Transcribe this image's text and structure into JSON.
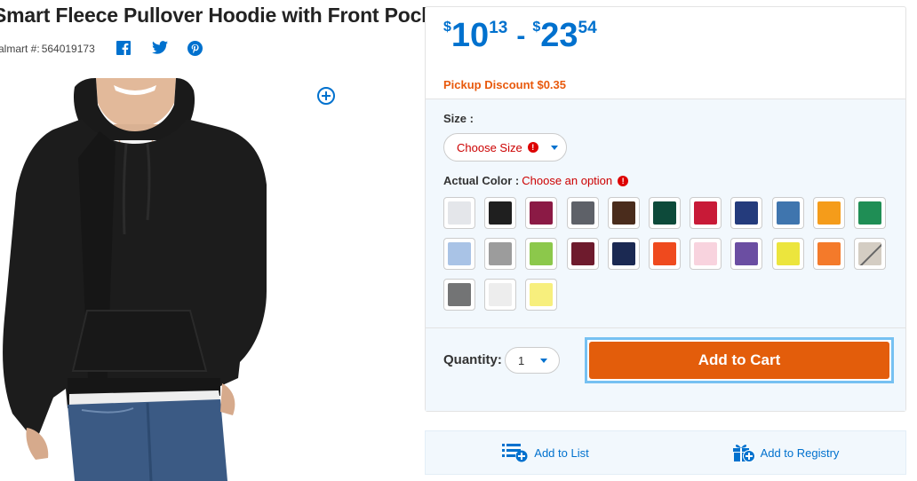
{
  "product": {
    "title": "Smart Fleece Pullover Hoodie with Front Pocket",
    "sku_label": "almart #:",
    "sku": "564019173"
  },
  "share": {
    "icons": [
      "facebook-icon",
      "twitter-icon",
      "pinterest-icon"
    ]
  },
  "price": {
    "currency": "$",
    "min_dollars": "10",
    "min_cents": "13",
    "separator": "-",
    "max_dollars": "23",
    "max_cents": "54",
    "color": "#0071ce"
  },
  "pickup_discount": "Pickup Discount $0.35",
  "size": {
    "label": "Size :",
    "selected": "Choose Size",
    "error_icon": "!"
  },
  "color": {
    "label": "Actual Color :",
    "hint": "Choose an option",
    "swatches": [
      {
        "name": "light-gray",
        "hex": "#e4e6ea"
      },
      {
        "name": "black",
        "hex": "#1f1f1f"
      },
      {
        "name": "maroon",
        "hex": "#8b1a45"
      },
      {
        "name": "charcoal",
        "hex": "#5e6168"
      },
      {
        "name": "brown",
        "hex": "#4a2c1c"
      },
      {
        "name": "forest-green",
        "hex": "#0d4a3a"
      },
      {
        "name": "red",
        "hex": "#c81a37"
      },
      {
        "name": "navy",
        "hex": "#243b7c"
      },
      {
        "name": "steel-blue",
        "hex": "#3f75ae"
      },
      {
        "name": "gold",
        "hex": "#f59c1a"
      },
      {
        "name": "kelly-green",
        "hex": "#1f8e55"
      },
      {
        "name": "light-blue",
        "hex": "#a9c3e6"
      },
      {
        "name": "heather-gray",
        "hex": "#9c9c9c"
      },
      {
        "name": "lime",
        "hex": "#8cc84b"
      },
      {
        "name": "burgundy",
        "hex": "#6e1b2d"
      },
      {
        "name": "deep-navy",
        "hex": "#1b2952"
      },
      {
        "name": "orange-red",
        "hex": "#ef4a1e"
      },
      {
        "name": "pink",
        "hex": "#f8d3de"
      },
      {
        "name": "purple",
        "hex": "#6b4ea2"
      },
      {
        "name": "yellow",
        "hex": "#ece53d"
      },
      {
        "name": "orange",
        "hex": "#f47a2a"
      },
      {
        "name": "sand-unavailable",
        "hex": "#d4cdc3",
        "unavailable": true
      },
      {
        "name": "slate",
        "hex": "#737475"
      },
      {
        "name": "off-white",
        "hex": "#ededed"
      },
      {
        "name": "pale-yellow",
        "hex": "#f7ef7d"
      }
    ]
  },
  "quantity": {
    "label": "Quantity:",
    "value": "1"
  },
  "add_to_cart": "Add to Cart",
  "add_to_list": "Add to List",
  "add_to_registry": "Add to Registry",
  "colors": {
    "accent": "#0071ce",
    "cart": "#e35d0b",
    "pickup": "#e8590c",
    "error": "#cc0000"
  }
}
